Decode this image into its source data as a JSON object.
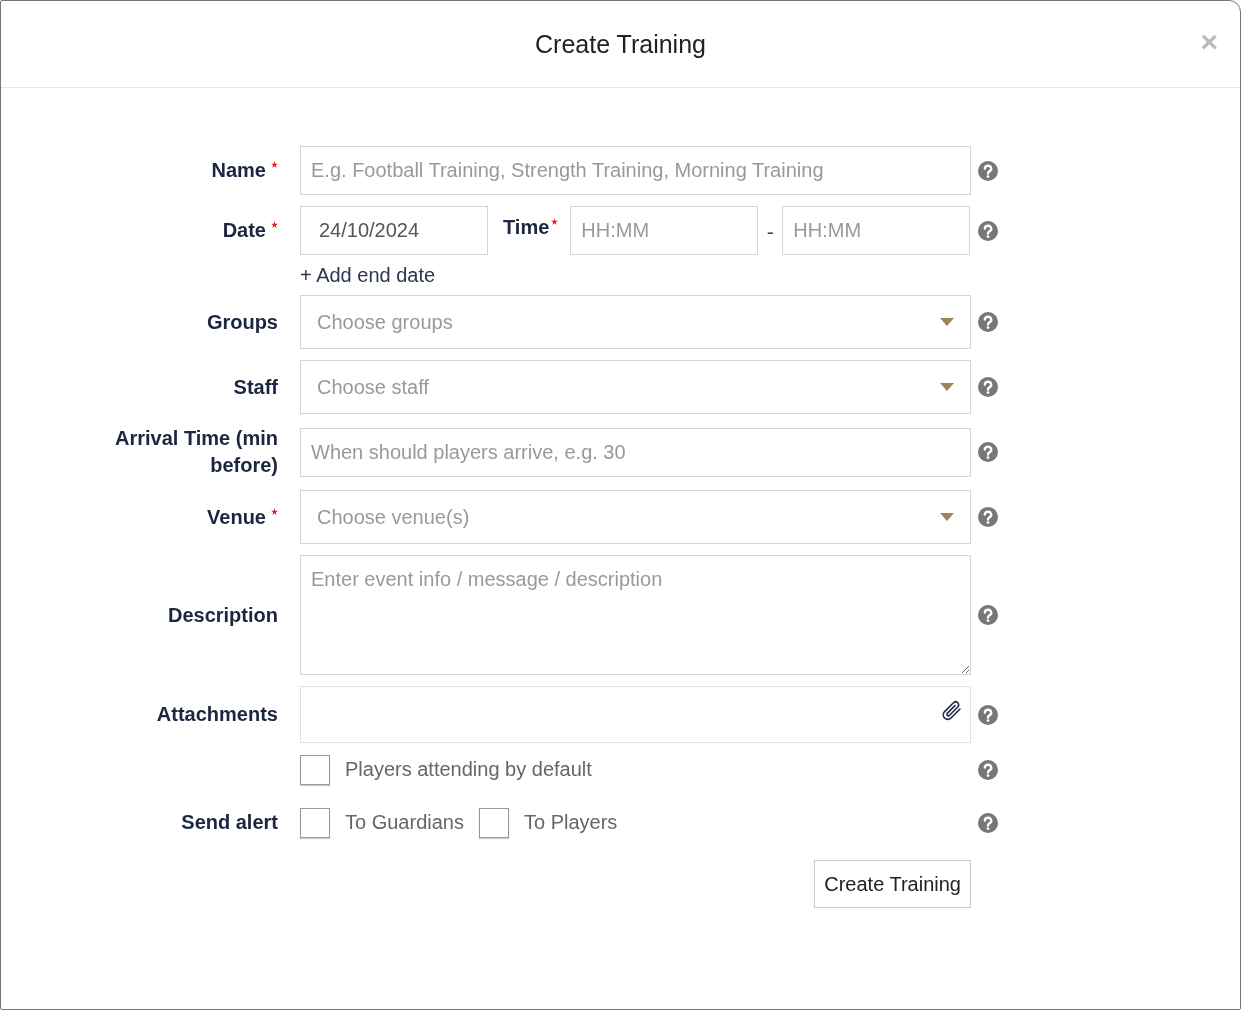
{
  "dialog": {
    "title": "Create Training",
    "close": "×"
  },
  "fields": [
    {
      "kind": "text",
      "label": "Name",
      "required": true,
      "placeholder": "E.g. Football Training, Strength Training, Morning Training"
    },
    {
      "kind": "datetime",
      "label": "Date",
      "required": true,
      "value": "24/10/2024",
      "time_label": "Time",
      "time_required": true,
      "start_placeholder": "HH:MM",
      "separator": "-",
      "end_placeholder": "HH:MM",
      "link": "+ Add end date"
    },
    {
      "kind": "select",
      "label": "Groups",
      "required": false,
      "placeholder": "Choose groups"
    },
    {
      "kind": "select",
      "label": "Staff",
      "required": false,
      "placeholder": "Choose staff"
    },
    {
      "kind": "text",
      "label": "Arrival Time (min before)",
      "required": false,
      "placeholder": "When should players arrive, e.g. 30"
    },
    {
      "kind": "select",
      "label": "Venue",
      "required": true,
      "placeholder": "Choose venue(s)"
    },
    {
      "kind": "textarea",
      "label": "Description",
      "required": false,
      "placeholder": "Enter event info / message / description"
    },
    {
      "kind": "file",
      "label": "Attachments",
      "required": false
    },
    {
      "kind": "checks",
      "required": false,
      "options": [
        {
          "label": "Players attending by default",
          "checked": false
        }
      ]
    },
    {
      "kind": "checks",
      "label": "Send alert",
      "required": false,
      "options": [
        {
          "label": "To Guardians",
          "checked": false
        },
        {
          "label": "To Players",
          "checked": false
        }
      ]
    }
  ],
  "submit": "Create Training"
}
